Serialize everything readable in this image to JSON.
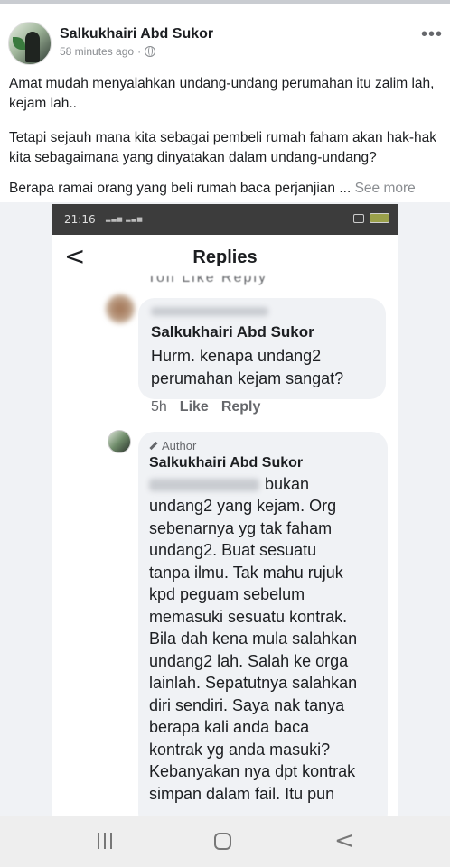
{
  "post": {
    "author": "Salkukhairi Abd Sukor",
    "time": "58 minutes ago",
    "separator": "·",
    "more_glyph": "•••",
    "paragraph1": "Amat mudah menyalahkan undang-undang perumahan itu zalim lah, kejam lah..",
    "paragraph2": "Tetapi sejauh mana kita sebagai pembeli rumah faham akan hak-hak kita sebagaimana yang dinyatakan dalam undang-undang?",
    "paragraph3": "Berapa ramai orang yang beli rumah baca perjanjian ...",
    "see_more": "See more"
  },
  "screenshot": {
    "status_time": "21:16",
    "replies_title": "Replies",
    "back_glyph": "<",
    "comment1": {
      "name": "Salkukhairi Abd Sukor",
      "text": "Hurm. kenapa undang2 perumahan kejam sangat?",
      "time": "5h",
      "like": "Like",
      "reply": "Reply"
    },
    "comment2": {
      "badge": "Author",
      "name": "Salkukhairi Abd Sukor",
      "line1": "bukan",
      "lines": [
        "undang2 yang kejam. Org",
        "sebenarnya yg tak faham",
        "undang2. Buat sesuatu",
        "tanpa ilmu. Tak mahu rujuk",
        "kpd peguam sebelum",
        "memasuki sesuatu kontrak.",
        "Bila dah kena mula salahkan",
        "undang2 lah. Salah ke orga",
        "lainlah. Sepatutnya salahkan",
        "diri sendiri. Saya nak tanya",
        "berapa kali anda baca",
        "kontrak yg anda masuki?",
        "Kebanyakan nya dpt kontrak",
        "simpan dalam fail. Itu pun"
      ]
    }
  },
  "navbar": {
    "back_glyph": "<"
  }
}
